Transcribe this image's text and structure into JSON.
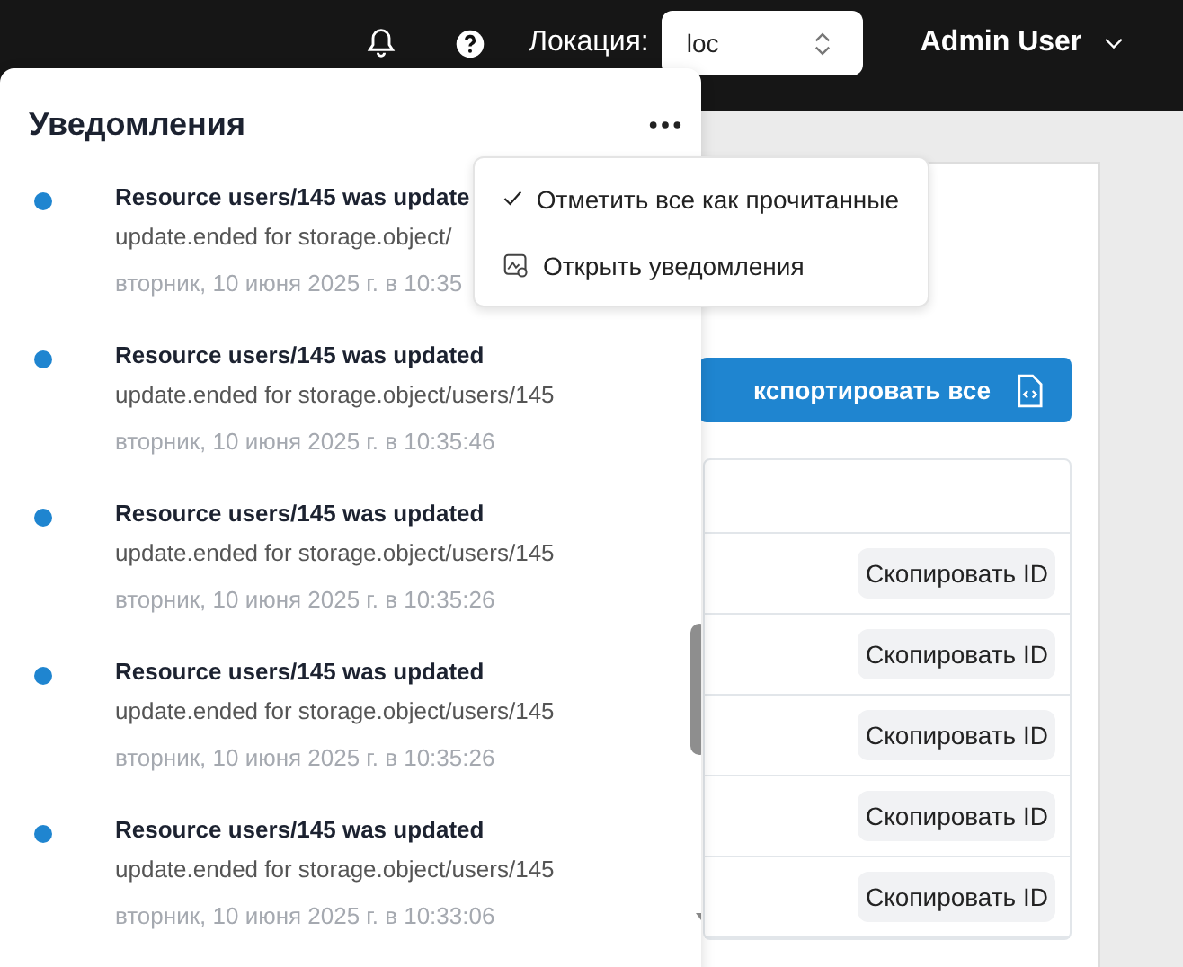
{
  "header": {
    "location_label": "Локация:",
    "location_value": "loc",
    "user": "Admin User"
  },
  "notifications": {
    "title": "Уведомления",
    "items": [
      {
        "title": "Resource users/145 was update",
        "body": "update.ended for storage.object/",
        "time": "вторник, 10 июня 2025 г. в 10:35",
        "unread": true
      },
      {
        "title": "Resource users/145 was updated",
        "body": "update.ended for storage.object/users/145",
        "time": "вторник, 10 июня 2025 г. в 10:35:46",
        "unread": true
      },
      {
        "title": "Resource users/145 was updated",
        "body": "update.ended for storage.object/users/145",
        "time": "вторник, 10 июня 2025 г. в 10:35:26",
        "unread": true
      },
      {
        "title": "Resource users/145 was updated",
        "body": "update.ended for storage.object/users/145",
        "time": "вторник, 10 июня 2025 г. в 10:35:26",
        "unread": true
      },
      {
        "title": "Resource users/145 was updated",
        "body": "update.ended for storage.object/users/145",
        "time": "вторник, 10 июня 2025 г. в 10:33:06",
        "unread": true
      }
    ]
  },
  "menu": [
    {
      "kind": "check",
      "label": "Отметить все как прочитанные"
    },
    {
      "kind": "open",
      "label": "Открыть уведомления"
    }
  ],
  "export_button": "кспортировать все",
  "table": {
    "rows": [
      {
        "action": "Скопировать ID"
      },
      {
        "action": "Скопировать ID"
      },
      {
        "action": "Скопировать ID"
      },
      {
        "action": "Скопировать ID"
      },
      {
        "action": "Скопировать ID"
      }
    ]
  }
}
